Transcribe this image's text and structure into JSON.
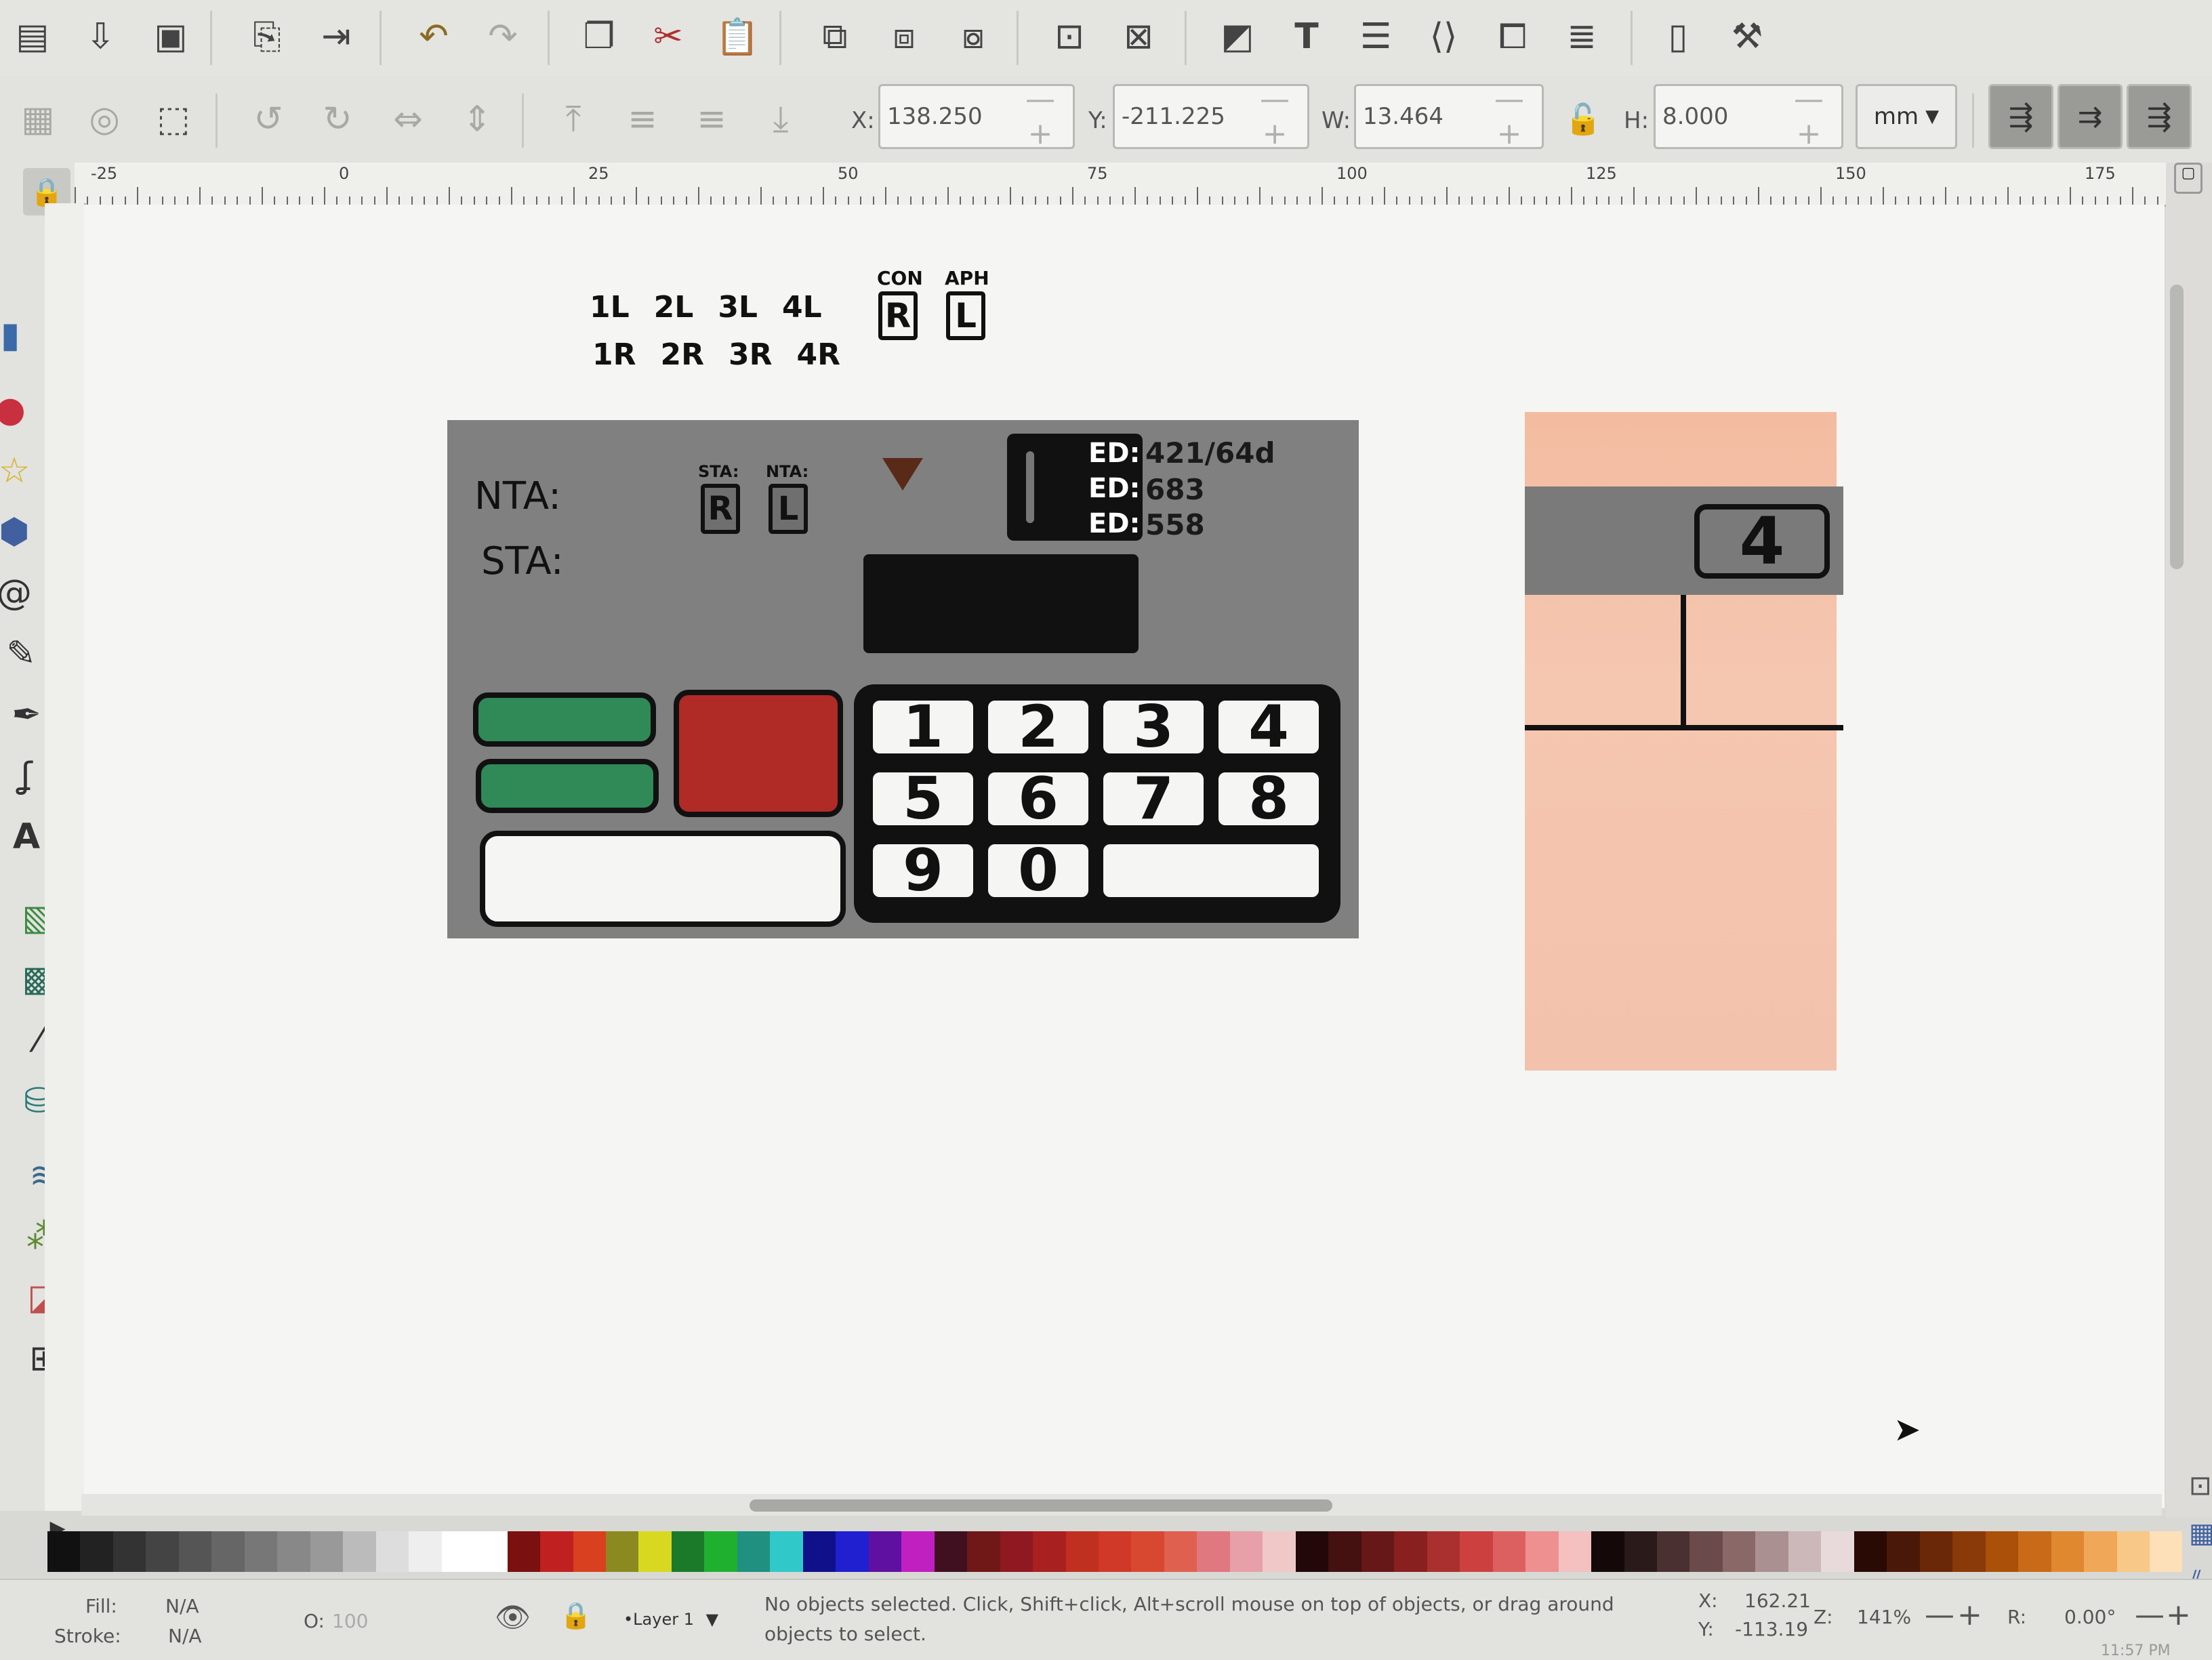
{
  "toolbar_commands": {
    "icons": [
      "open-icon",
      "import-icon",
      "save-icon",
      "import-doc-icon",
      "export-icon",
      "undo-icon",
      "redo-icon",
      "duplicate-icon",
      "cut-icon",
      "paste-icon",
      "group-icon",
      "clone-icon",
      "unclone-icon",
      "zoom-selection-icon",
      "zoom-drawing-icon",
      "fill-stroke-icon",
      "text-tool-icon",
      "layers-icon",
      "xml-editor-icon",
      "object-properties-icon",
      "align-icon",
      "document-properties-icon",
      "preferences-icon"
    ]
  },
  "select_controls": {
    "x_label": "X:",
    "x_value": "138.250",
    "y_label": "Y:",
    "y_value": "-211.225",
    "w_label": "W:",
    "w_value": "13.464",
    "h_label": "H:",
    "h_value": "8.000",
    "unit": "mm",
    "spin_symbols": "—+"
  },
  "ruler": {
    "labels": [
      "-25",
      "0",
      "25",
      "50",
      "75",
      "100",
      "125",
      "150",
      "175"
    ]
  },
  "drawing": {
    "legend_row1": [
      "1L",
      "2L",
      "3L",
      "4L"
    ],
    "legend_row2": [
      "1R",
      "2R",
      "3R",
      "4R"
    ],
    "con_label": "CON",
    "con_value": "R",
    "aph_label": "APH",
    "aph_value": "L",
    "nta_label": "NTA:",
    "sta_label": "STA:",
    "small_sta_label": "STA:",
    "small_sta_value": "R",
    "small_nta_label": "NTA:",
    "small_nta_value": "L",
    "ed_label": "ED:",
    "ed_values": [
      "421/64d",
      "683",
      "558"
    ],
    "keypad": [
      "1",
      "2",
      "3",
      "4",
      "5",
      "6",
      "7",
      "8",
      "9",
      "0"
    ],
    "side_badge": "4"
  },
  "colors": {
    "panel_gray": "#808080",
    "button_green": "#2f8a58",
    "button_red": "#b02a26",
    "peach": "#f2c0a8"
  },
  "statusbar": {
    "fill_label": "Fill:",
    "fill_value": "N/A",
    "stroke_label": "Stroke:",
    "stroke_value": "N/A",
    "opacity_label": "O:",
    "opacity_value": "100",
    "layer": "•Layer 1",
    "message": "No objects selected. Click, Shift+click, Alt+scroll mouse on top of objects, or drag around objects to select.",
    "cursor_x_label": "X:",
    "cursor_x": "162.21",
    "cursor_y_label": "Y:",
    "cursor_y": "-113.19",
    "zoom_label": "Z:",
    "zoom": "141%",
    "rotation_label": "R:",
    "rotation": "0.00°",
    "clock": "11:57 PM"
  }
}
